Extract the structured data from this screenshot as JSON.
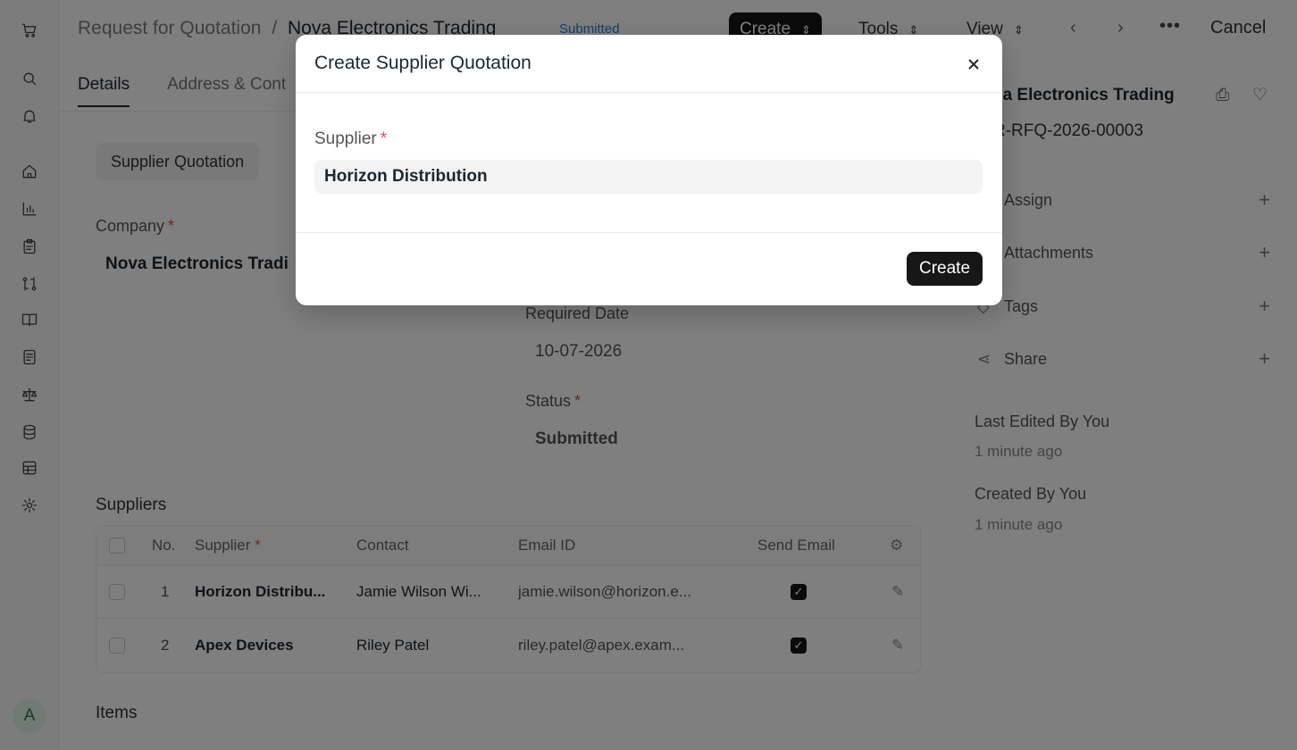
{
  "header": {
    "breadcrumb_parent": "Request for Quotation",
    "breadcrumb_sep": "/",
    "title": "Nova Electronics Trading",
    "status": "Submitted",
    "create_label": "Create",
    "tools_label": "Tools",
    "view_label": "View",
    "cancel_label": "Cancel"
  },
  "tabs": [
    {
      "label": "Details"
    },
    {
      "label": "Address & Cont"
    }
  ],
  "form": {
    "section_button": "Supplier Quotation",
    "company_label": "Company",
    "company_value": "Nova Electronics Tradi",
    "required_date_label": "Required Date",
    "required_date_value": "10-07-2026",
    "status_label": "Status",
    "status_value": "Submitted",
    "suppliers_title": "Suppliers",
    "items_title": "Items"
  },
  "suppliers_table": {
    "headers": {
      "no": "No.",
      "supplier": "Supplier",
      "contact": "Contact",
      "email": "Email ID",
      "send_email": "Send Email"
    },
    "rows": [
      {
        "no": "1",
        "supplier": "Horizon Distribu...",
        "contact": "Jamie Wilson Wi...",
        "email": "jamie.wilson@horizon.e...",
        "send_email": true
      },
      {
        "no": "2",
        "supplier": "Apex Devices",
        "contact": "Riley Patel",
        "email": "riley.patel@apex.exam...",
        "send_email": true
      }
    ]
  },
  "right_panel": {
    "title": "va Electronics Trading",
    "doc_id": "R-RFQ-2026-00003",
    "assign": "Assign",
    "attachments": "Attachments",
    "tags": "Tags",
    "share": "Share",
    "last_edited": "Last Edited By You",
    "last_edited_time": "1 minute ago",
    "created": "Created By You",
    "created_time": "1 minute ago"
  },
  "user": {
    "avatar_initial": "A"
  },
  "modal": {
    "title": "Create Supplier Quotation",
    "supplier_label": "Supplier",
    "required_mark": "*",
    "supplier_value": "Horizon Distribution",
    "create_button": "Create"
  }
}
